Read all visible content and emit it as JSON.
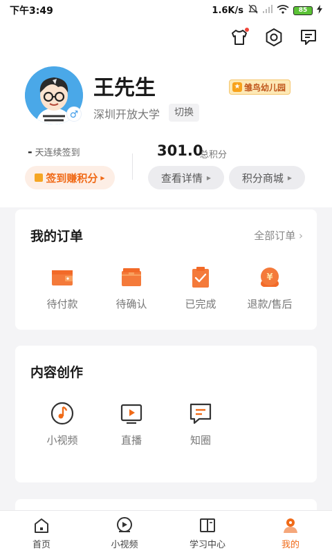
{
  "status_bar": {
    "time": "下午3:49",
    "network_speed": "1.6K/s",
    "battery": "85"
  },
  "header": {
    "icons": [
      "shirt-icon",
      "settings-icon",
      "message-icon"
    ]
  },
  "profile": {
    "name": "王先生",
    "level_badge": "雏鸟幼儿园",
    "school": "深圳开放大学",
    "switch_label": "切换",
    "gender_symbol": "♂"
  },
  "sign_in": {
    "streak_value": "-",
    "streak_label": "天连续签到",
    "button_label": "签到赚积分"
  },
  "points": {
    "value": "301.0",
    "label": "总积分",
    "details_label": "查看详情",
    "mall_label": "积分商城"
  },
  "orders": {
    "title": "我的订单",
    "all_label": "全部订单",
    "items": [
      {
        "label": "待付款",
        "icon": "wallet-icon"
      },
      {
        "label": "待确认",
        "icon": "package-icon"
      },
      {
        "label": "已完成",
        "icon": "clipboard-check-icon"
      },
      {
        "label": "退款/售后",
        "icon": "refund-yen-icon"
      }
    ]
  },
  "content_creation": {
    "title": "内容创作",
    "items": [
      {
        "label": "小视频",
        "icon": "music-note-icon"
      },
      {
        "label": "直播",
        "icon": "play-screen-icon"
      },
      {
        "label": "知圈",
        "icon": "chat-bubble-icon"
      }
    ]
  },
  "bottom_nav": {
    "items": [
      {
        "label": "首页",
        "icon": "home-icon"
      },
      {
        "label": "小视频",
        "icon": "video-play-icon"
      },
      {
        "label": "学习中心",
        "icon": "book-icon"
      },
      {
        "label": "我的",
        "icon": "profile-icon"
      }
    ],
    "active_index": 3
  },
  "colors": {
    "accent": "#f06a17",
    "background": "#f4f4f6"
  }
}
